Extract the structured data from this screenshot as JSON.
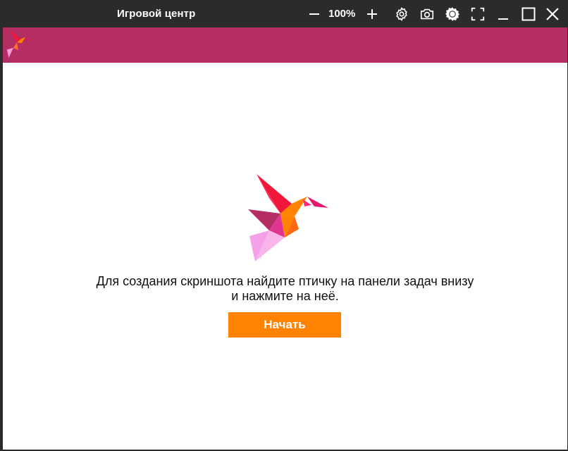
{
  "window": {
    "title": "Игровой центр",
    "zoom_level": "100%",
    "icons": [
      "minus-icon",
      "plus-icon",
      "gear-icon",
      "camera-icon",
      "brightness-icon",
      "fullscreen-icon",
      "minimize-icon",
      "maximize-icon",
      "close-icon"
    ]
  },
  "header": {
    "logo_icon": "hummingbird-logo-icon",
    "background_color": "#b42d63"
  },
  "main": {
    "illustration_icon": "hummingbird-icon",
    "message_line1": "Для создания скриншота найдите птичку на панели задач внизу",
    "message_line2": "и нажмите на неё.",
    "start_button_label": "Начать",
    "accent_color": "#ff8201"
  }
}
